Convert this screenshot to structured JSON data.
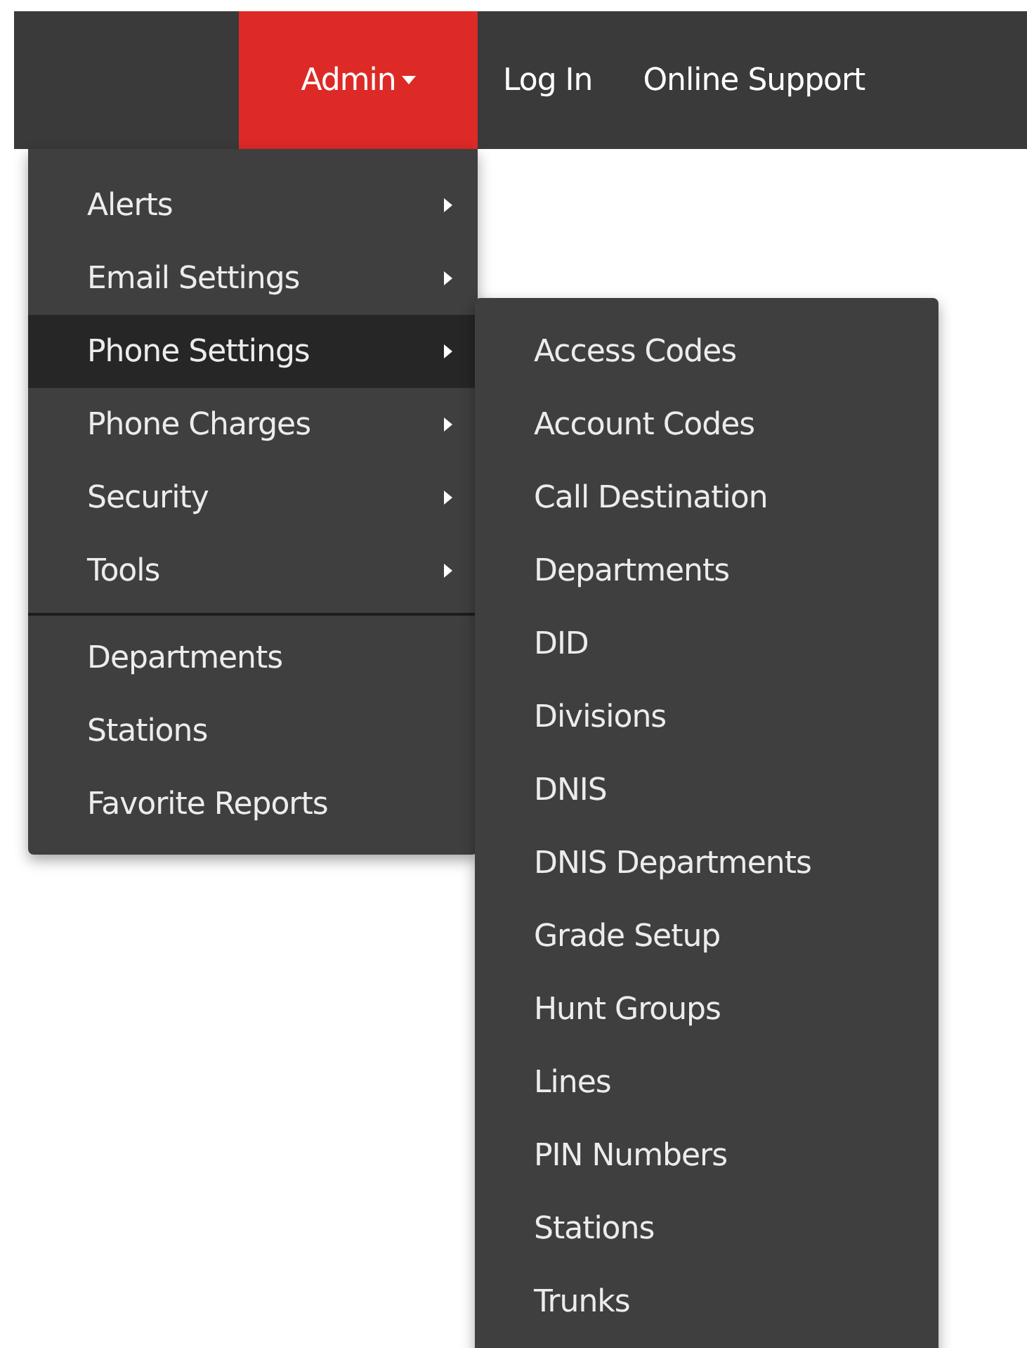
{
  "nav": [
    {
      "label": "Admin",
      "selected": true,
      "has_dropdown": true
    },
    {
      "label": "Log In",
      "selected": false,
      "has_dropdown": false
    },
    {
      "label": "Online Support",
      "selected": false,
      "has_dropdown": false
    }
  ],
  "admin_menu": {
    "sections": [
      [
        {
          "label": "Alerts",
          "kind": "submenu",
          "selected": false
        },
        {
          "label": "Email Settings",
          "kind": "submenu",
          "selected": false
        },
        {
          "label": "Phone Settings",
          "kind": "submenu",
          "selected": true
        },
        {
          "label": "Phone Charges",
          "kind": "submenu",
          "selected": false
        },
        {
          "label": "Security",
          "kind": "submenu",
          "selected": false
        },
        {
          "label": "Tools",
          "kind": "submenu",
          "selected": false
        }
      ],
      [
        {
          "label": "Departments",
          "kind": "link",
          "selected": false
        },
        {
          "label": "Stations",
          "kind": "link",
          "selected": false
        },
        {
          "label": "Favorite Reports",
          "kind": "link",
          "selected": false
        }
      ]
    ]
  },
  "phone_settings_menu": {
    "items": [
      "Access Codes",
      "Account Codes",
      "Call Destination",
      "Departments",
      "DID",
      "Divisions",
      "DNIS",
      "DNIS Departments",
      "Grade Setup",
      "Hunt Groups",
      "Lines",
      "PIN Numbers",
      "Stations",
      "Trunks"
    ]
  }
}
